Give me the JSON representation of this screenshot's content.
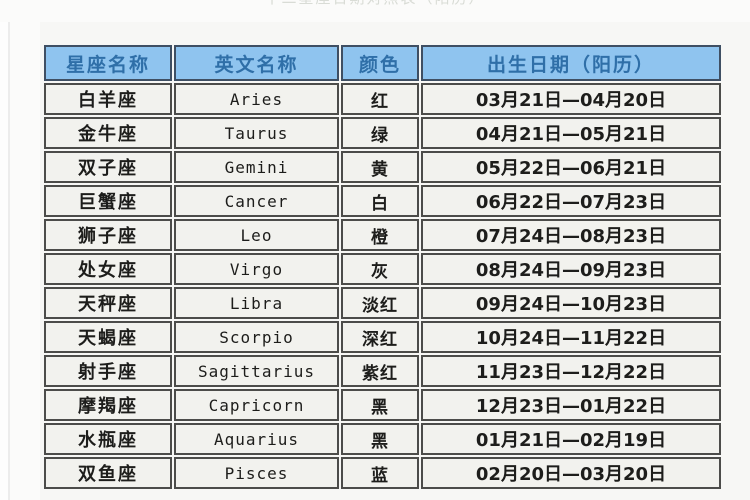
{
  "caption": {
    "text": "十二星座日期对照表（阳历）"
  },
  "table": {
    "headers": [
      "星座名称",
      "英文名称",
      "颜色",
      "出生日期（阳历）"
    ],
    "header_bg": "#8fc4ef",
    "header_text_color": "#2f6fa8",
    "cell_bg": "#f2f2ee",
    "border_color": "#4c4c4a",
    "rows": [
      {
        "name": "白羊座",
        "english": "Aries",
        "color": "红",
        "dates": "03月21日—04月20日"
      },
      {
        "name": "金牛座",
        "english": "Taurus",
        "color": "绿",
        "dates": "04月21日—05月21日"
      },
      {
        "name": "双子座",
        "english": "Gemini",
        "color": "黄",
        "dates": "05月22日—06月21日"
      },
      {
        "name": "巨蟹座",
        "english": "Cancer",
        "color": "白",
        "dates": "06月22日—07月23日"
      },
      {
        "name": "狮子座",
        "english": "Leo",
        "color": "橙",
        "dates": "07月24日—08月23日"
      },
      {
        "name": "处女座",
        "english": "Virgo",
        "color": "灰",
        "dates": "08月24日—09月23日"
      },
      {
        "name": "天秤座",
        "english": "Libra",
        "color": "淡红",
        "dates": "09月24日—10月23日"
      },
      {
        "name": "天蝎座",
        "english": "Scorpio",
        "color": "深红",
        "dates": "10月24日—11月22日"
      },
      {
        "name": "射手座",
        "english": "Sagittarius",
        "color": "紫红",
        "dates": "11月23日—12月22日"
      },
      {
        "name": "摩羯座",
        "english": "Capricorn",
        "color": "黑",
        "dates": "12月23日—01月22日"
      },
      {
        "name": "水瓶座",
        "english": "Aquarius",
        "color": "黑",
        "dates": "01月21日—02月19日"
      },
      {
        "name": "双鱼座",
        "english": "Pisces",
        "color": "蓝",
        "dates": "02月20日—03月20日"
      }
    ]
  }
}
